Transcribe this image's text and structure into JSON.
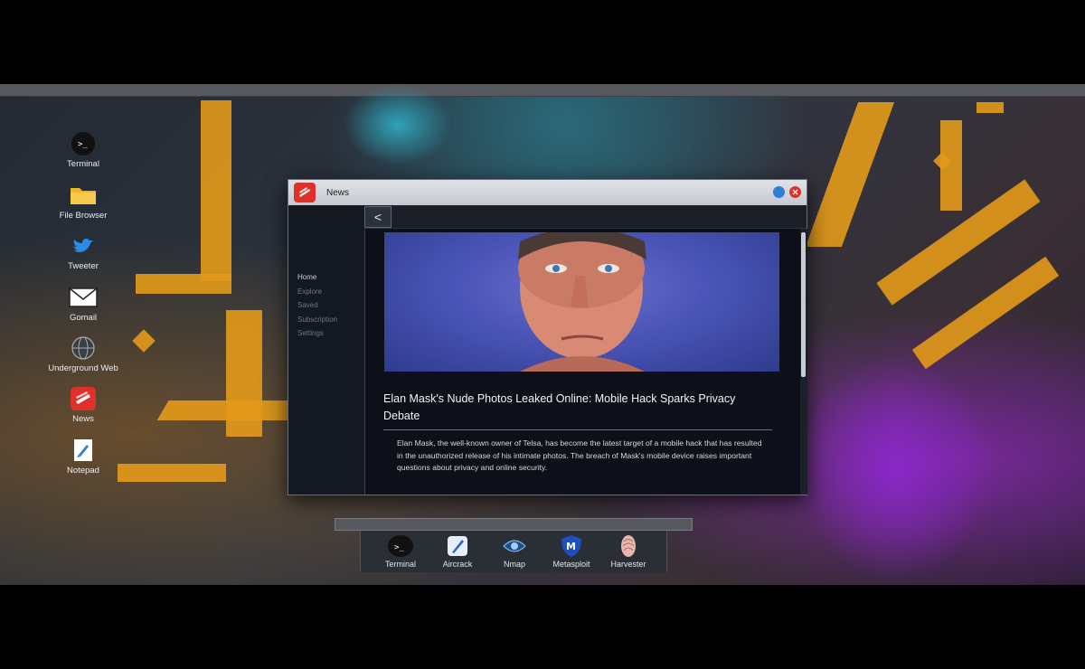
{
  "desktop": {
    "icons": [
      {
        "label": "Terminal",
        "icon": "terminal-icon"
      },
      {
        "label": "File Browser",
        "icon": "folder-icon"
      },
      {
        "label": "Tweeter",
        "icon": "bird-icon"
      },
      {
        "label": "Gomail",
        "icon": "mail-icon"
      },
      {
        "label": "Underground Web",
        "icon": "globe-icon"
      },
      {
        "label": "News",
        "icon": "news-icon"
      },
      {
        "label": "Notepad",
        "icon": "notepad-icon"
      }
    ]
  },
  "window": {
    "title": "News",
    "back_label": "<",
    "nav": [
      {
        "label": "Home",
        "active": true
      },
      {
        "label": "Explore",
        "active": false
      },
      {
        "label": "Saved",
        "active": false
      },
      {
        "label": "Subscription",
        "active": false
      },
      {
        "label": "Settings",
        "active": false
      }
    ],
    "article": {
      "headline": "Elan Mask's Nude Photos Leaked Online: Mobile Hack Sparks Privacy Debate",
      "summary": "Elan Mask, the well-known owner of Telsa, has become the latest target of a mobile hack that has resulted in the unauthorized release of his intimate photos. The breach of Mask's mobile device raises important questions about privacy and online security."
    }
  },
  "dock": {
    "items": [
      {
        "label": "Terminal",
        "icon": "terminal-icon"
      },
      {
        "label": "Aircrack",
        "icon": "aircrack-icon"
      },
      {
        "label": "Nmap",
        "icon": "eye-icon"
      },
      {
        "label": "Metasploit",
        "icon": "shield-icon"
      },
      {
        "label": "Harvester",
        "icon": "fingerprint-icon"
      }
    ]
  },
  "colors": {
    "accent_red": "#e0302a",
    "wallpaper_orange": "#e39a1a",
    "window_bg": "#11151c"
  }
}
